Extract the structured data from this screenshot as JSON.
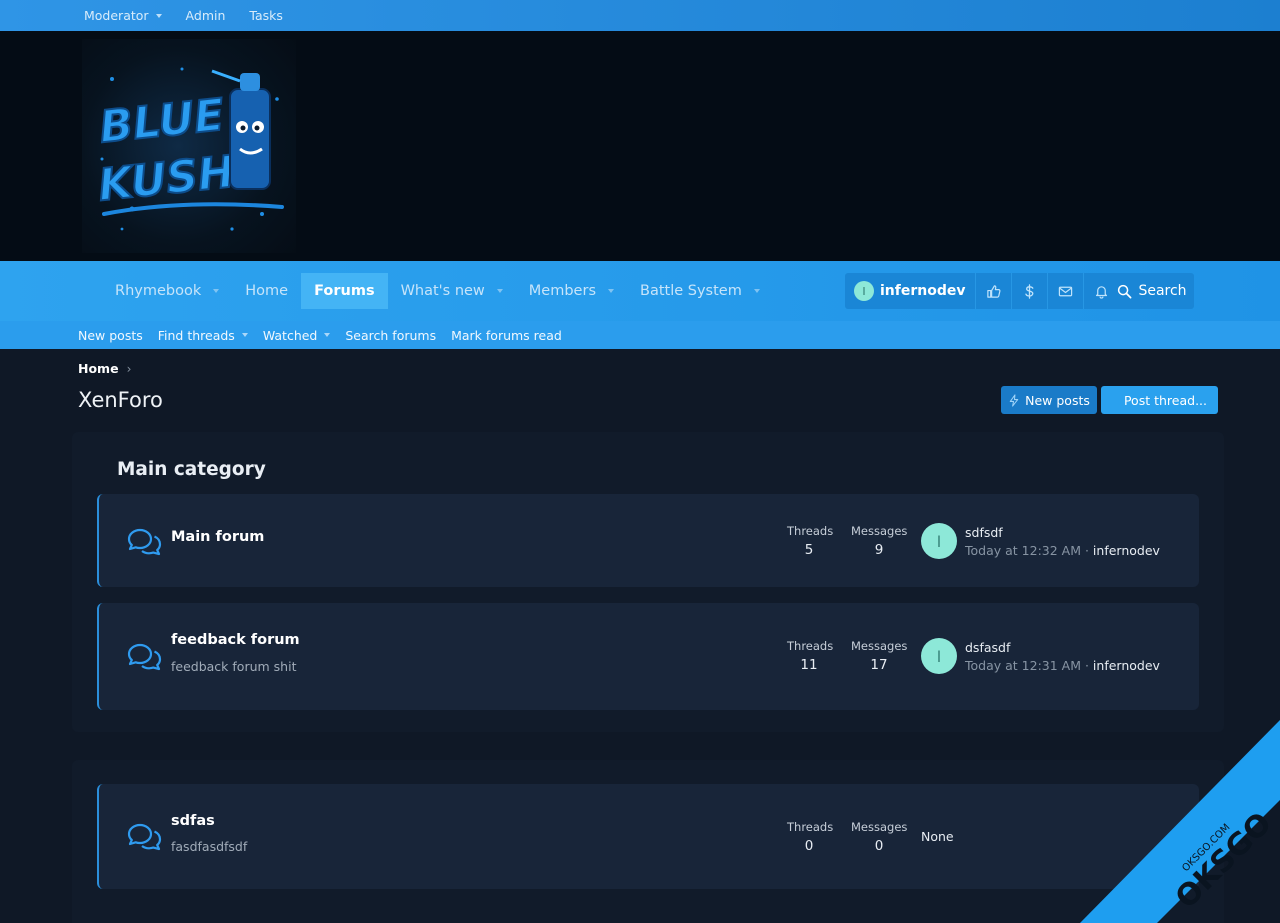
{
  "staffbar": {
    "moderator": "Moderator",
    "admin": "Admin",
    "tasks": "Tasks"
  },
  "logo": {
    "line1": "BLUE",
    "line2": "KUSH"
  },
  "nav": {
    "tabs": [
      {
        "label": "Rhymebook"
      },
      {
        "label": "Home"
      },
      {
        "label": "Forums"
      },
      {
        "label": "What's new"
      },
      {
        "label": "Members"
      },
      {
        "label": "Battle System"
      }
    ],
    "user": {
      "initial": "I",
      "name": "infernodev"
    },
    "search_label": "Search"
  },
  "subnav": {
    "items": [
      "New posts",
      "Find threads",
      "Watched",
      "Search forums",
      "Mark forums read"
    ]
  },
  "breadcrumb": {
    "home": "Home",
    "sep": "›"
  },
  "page": {
    "title": "XenForo",
    "new_posts_label": "New posts",
    "post_thread_label": "Post thread..."
  },
  "category": {
    "title": "Main category"
  },
  "labels": {
    "threads": "Threads",
    "messages": "Messages"
  },
  "forums": [
    {
      "title": "Main forum",
      "description": "",
      "threads": "5",
      "messages": "9",
      "last_initial": "I",
      "last_title": "sdfsdf",
      "last_time": "Today at 12:32 AM",
      "last_sep": " · ",
      "last_user": "infernodev"
    },
    {
      "title": "feedback forum",
      "description": "feedback forum shit",
      "threads": "11",
      "messages": "17",
      "last_initial": "I",
      "last_title": "dsfasdf",
      "last_time": "Today at 12:31 AM",
      "last_sep": " · ",
      "last_user": "infernodev"
    },
    {
      "title": "sdfas",
      "description": "fasdfasdfsdf",
      "threads": "0",
      "messages": "0",
      "last_none": "None"
    }
  ],
  "watermark": {
    "brand": "OKSGO",
    "site": "OKSGO.COM"
  },
  "colors": {
    "accent": "#2ea3ef",
    "page_bg": "#0f1826",
    "node_bg": "#182539",
    "avatar": "#8de8d8"
  }
}
